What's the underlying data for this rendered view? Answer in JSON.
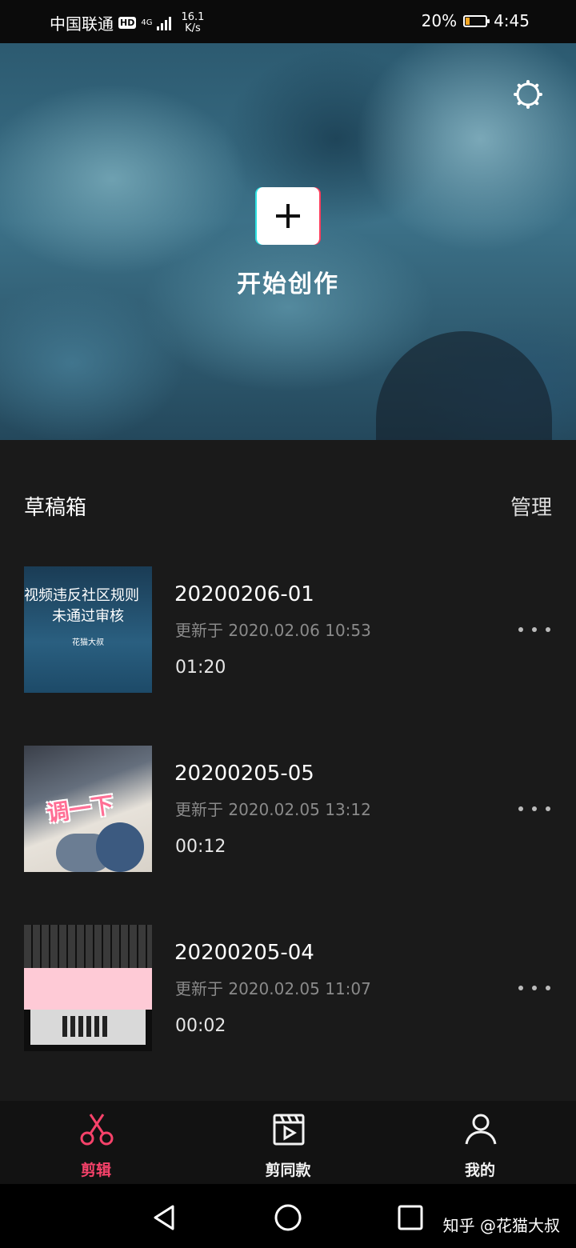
{
  "status_bar": {
    "carrier": "中国联通",
    "hd_badge": "HD",
    "network_type": "4G",
    "speed_value": "16.1",
    "speed_unit": "K/s",
    "battery": "20%",
    "battery_level": 0.2,
    "time": "4:45"
  },
  "hero": {
    "create_label": "开始创作",
    "accent_cyan": "#2de1e1",
    "accent_pink": "#fd3d5c"
  },
  "drafts": {
    "title": "草稿箱",
    "manage_label": "管理",
    "items": [
      {
        "name": "20200206-01",
        "updated": "更新于 2020.02.06 10:53",
        "duration": "01:20",
        "thumb_text_line1": "视频违反社区规则",
        "thumb_text_line2": "未通过审核",
        "thumb_text_line3": "花猫大叔"
      },
      {
        "name": "20200205-05",
        "updated": "更新于 2020.02.05 13:12",
        "duration": "00:12",
        "thumb_caption": "调一下"
      },
      {
        "name": "20200205-04",
        "updated": "更新于 2020.02.05 11:07",
        "duration": "00:02"
      }
    ]
  },
  "bottom_nav": {
    "items": [
      {
        "label": "剪辑",
        "icon": "scissors-icon",
        "active": true
      },
      {
        "label": "剪同款",
        "icon": "clapperboard-icon",
        "active": false
      },
      {
        "label": "我的",
        "icon": "person-icon",
        "active": false
      }
    ],
    "active_color": "#f7426a"
  },
  "system_bar": {
    "watermark": "知乎 @花猫大叔"
  }
}
